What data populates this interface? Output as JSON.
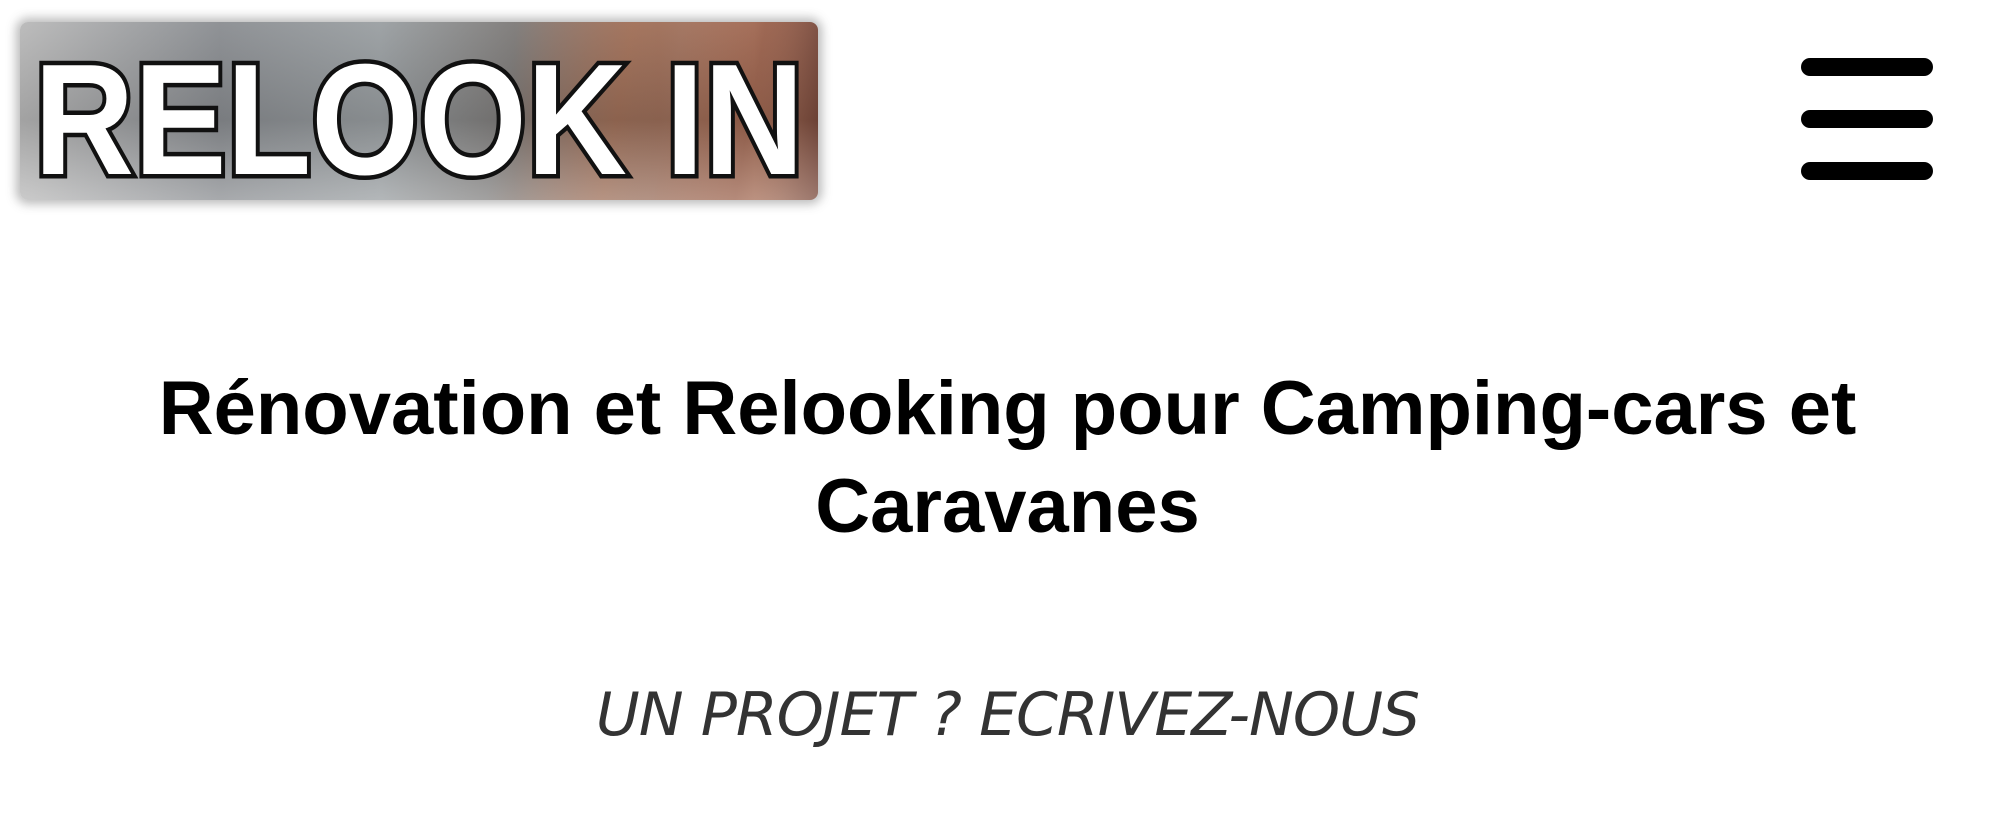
{
  "header": {
    "logo_text": "RELOOK IN",
    "menu_icon": "hamburger-menu-icon"
  },
  "hero": {
    "headline": "Rénovation et Relooking pour Camping-cars et Caravanes",
    "cta_label": "UN PROJET ? ECRIVEZ-NOUS"
  },
  "colors": {
    "text": "#000000",
    "cta_text": "#333333",
    "background": "#ffffff"
  }
}
